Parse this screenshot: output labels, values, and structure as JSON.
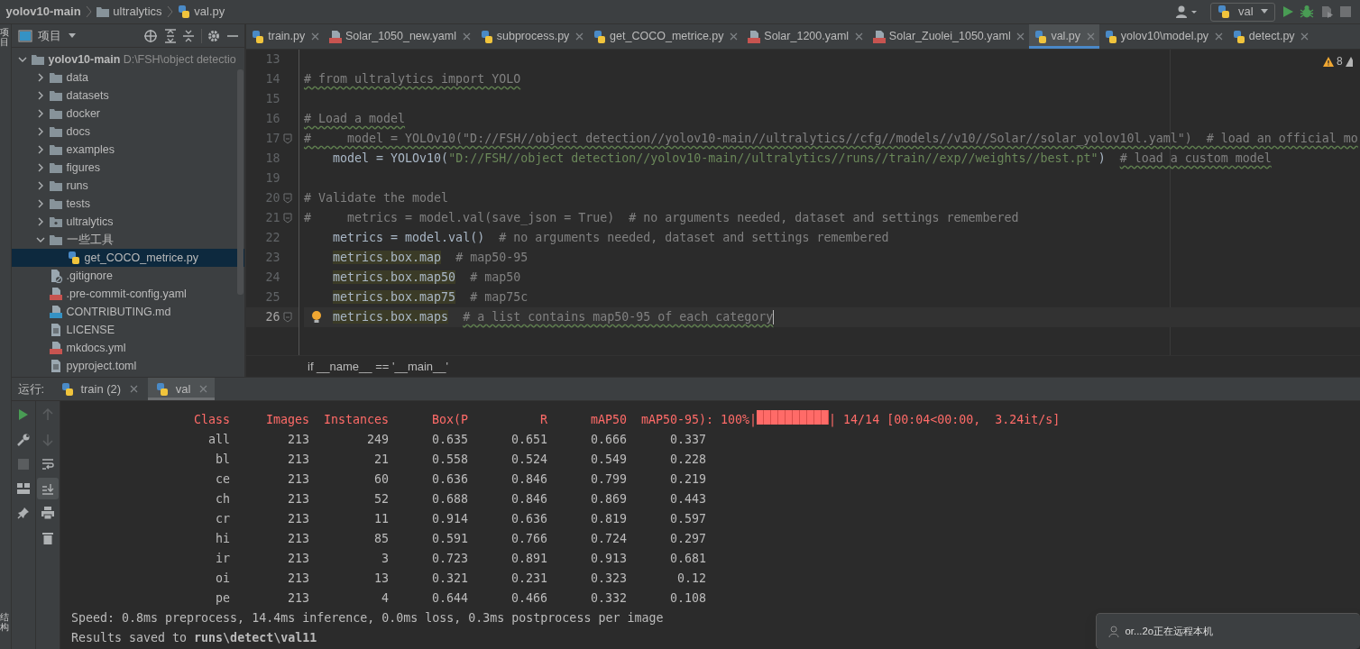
{
  "breadcrumb": [
    {
      "text": "yolov10-main",
      "kind": "project"
    },
    {
      "text": "ultralytics",
      "kind": "folder"
    },
    {
      "text": "val.py",
      "kind": "py"
    }
  ],
  "toolbar": {
    "run_config": "val"
  },
  "left_strip": {
    "top_label": "项目",
    "bottom_label": "结构"
  },
  "project_panel": {
    "title": "项目",
    "tree": [
      {
        "label": "yolov10-main",
        "path": "D:\\FSH\\object detectio",
        "kind": "root",
        "expanded": true,
        "selected": false,
        "children": [
          {
            "label": "data",
            "kind": "folder",
            "expanded": false,
            "selected": false
          },
          {
            "label": "datasets",
            "kind": "folder",
            "expanded": false,
            "selected": false
          },
          {
            "label": "docker",
            "kind": "folder",
            "expanded": false,
            "selected": false
          },
          {
            "label": "docs",
            "kind": "folder",
            "expanded": false,
            "selected": false
          },
          {
            "label": "examples",
            "kind": "folder",
            "expanded": false,
            "selected": false
          },
          {
            "label": "figures",
            "kind": "folder",
            "expanded": false,
            "selected": false
          },
          {
            "label": "runs",
            "kind": "folder",
            "expanded": false,
            "selected": false
          },
          {
            "label": "tests",
            "kind": "folder",
            "expanded": false,
            "selected": false
          },
          {
            "label": "ultralytics",
            "kind": "package",
            "expanded": false,
            "selected": false
          },
          {
            "label": "一些工具",
            "kind": "folder",
            "expanded": true,
            "selected": false,
            "children": [
              {
                "label": "get_COCO_metrice.py",
                "kind": "py",
                "selected": true
              }
            ]
          },
          {
            "label": ".gitignore",
            "kind": "ignore",
            "selected": false
          },
          {
            "label": ".pre-commit-config.yaml",
            "kind": "yaml",
            "selected": false
          },
          {
            "label": "CONTRIBUTING.md",
            "kind": "md",
            "selected": false
          },
          {
            "label": "LICENSE",
            "kind": "text",
            "selected": false
          },
          {
            "label": "mkdocs.yml",
            "kind": "yaml",
            "selected": false
          },
          {
            "label": "pyproject.toml",
            "kind": "text",
            "selected": false
          }
        ]
      }
    ]
  },
  "editor_tabs": [
    {
      "label": "train.py",
      "kind": "py",
      "selected": false
    },
    {
      "label": "Solar_1050_new.yaml",
      "kind": "yaml",
      "selected": false
    },
    {
      "label": "subprocess.py",
      "kind": "py",
      "selected": false
    },
    {
      "label": "get_COCO_metrice.py",
      "kind": "py",
      "selected": false
    },
    {
      "label": "Solar_1200.yaml",
      "kind": "yaml",
      "selected": false
    },
    {
      "label": "Solar_Zuolei_1050.yaml",
      "kind": "yaml",
      "selected": false
    },
    {
      "label": "val.py",
      "kind": "py",
      "selected": true
    },
    {
      "label": "yolov10\\model.py",
      "kind": "py",
      "selected": false
    },
    {
      "label": "detect.py",
      "kind": "py",
      "selected": false
    }
  ],
  "editor": {
    "warnings": "8",
    "lines": [
      {
        "number": "13",
        "fold": false,
        "current": false,
        "hint": false
      },
      {
        "number": "14",
        "fold": false,
        "current": false,
        "hint": false,
        "segments": [
          {
            "kind": "comment_warn",
            "text": "# from ultralytics import YOLO"
          }
        ]
      },
      {
        "number": "15",
        "fold": false,
        "current": false,
        "hint": false
      },
      {
        "number": "16",
        "fold": false,
        "current": false,
        "hint": false,
        "segments": [
          {
            "kind": "comment_warn",
            "text": "# Load a model"
          }
        ]
      },
      {
        "number": "17",
        "fold": true,
        "current": false,
        "hint": false,
        "segments": [
          {
            "kind": "comment_warn",
            "text": "#     model = YOLOv10(\"D://FSH//object detection//yolov10-main//ultralytics//cfg//models//v10//Solar//solar_yolov10l.yaml\")  # load an official mo"
          }
        ]
      },
      {
        "number": "18",
        "fold": false,
        "current": false,
        "hint": false,
        "segments": [
          {
            "kind": "code",
            "text": "    model = YOLOv10("
          },
          {
            "kind": "string",
            "text": "\"D://FSH//object detection//yolov10-main//ultralytics//runs//train//exp//weights//best.pt\""
          },
          {
            "kind": "code",
            "text": ")  "
          },
          {
            "kind": "comment_warn",
            "text": "# load a custom model"
          }
        ]
      },
      {
        "number": "19",
        "fold": false,
        "current": false,
        "hint": false
      },
      {
        "number": "20",
        "fold": true,
        "current": false,
        "hint": false,
        "segments": [
          {
            "kind": "comment",
            "text": "# Validate the model"
          }
        ]
      },
      {
        "number": "21",
        "fold": true,
        "current": false,
        "hint": false,
        "segments": [
          {
            "kind": "comment",
            "text": "#     metrics = model.val(save_json = True)  # no arguments needed, dataset and settings remembered"
          }
        ]
      },
      {
        "number": "22",
        "fold": false,
        "current": false,
        "hint": false,
        "segments": [
          {
            "kind": "code",
            "text": "    metrics = model.val()  "
          },
          {
            "kind": "comment",
            "text": "# no arguments needed, dataset and settings remembered"
          }
        ]
      },
      {
        "number": "23",
        "fold": false,
        "current": false,
        "hint": false,
        "indented": true,
        "segments": [
          {
            "kind": "highlight",
            "text": "metrics.box.map"
          },
          {
            "kind": "comment",
            "text": "  # map50-95"
          }
        ]
      },
      {
        "number": "24",
        "fold": false,
        "current": false,
        "hint": false,
        "indented": true,
        "segments": [
          {
            "kind": "highlight",
            "text": "metrics.box.map50"
          },
          {
            "kind": "comment",
            "text": "  # map50"
          }
        ]
      },
      {
        "number": "25",
        "fold": false,
        "current": false,
        "hint": false,
        "indented": true,
        "segments": [
          {
            "kind": "highlight",
            "text": "metrics.box.map75"
          },
          {
            "kind": "comment",
            "text": "  # map75c"
          }
        ]
      },
      {
        "number": "26",
        "fold": true,
        "current": true,
        "hint": true,
        "indented": true,
        "segments": [
          {
            "kind": "highlight",
            "text": "metrics.box.maps"
          },
          {
            "kind": "comment_warn",
            "text": "  # a list contains map50-95 of each category"
          }
        ]
      }
    ]
  },
  "editor_breadcrumb": "if __name__ == '__main__'",
  "run_panel": {
    "label": "运行:",
    "tabs": [
      {
        "label": "train (2)",
        "selected": false
      },
      {
        "label": "val",
        "selected": true
      }
    ],
    "console": {
      "header": {
        "columns": [
          "Class",
          "Images",
          "Instances",
          "Box(P",
          "R",
          "mAP50",
          "mAP50-95):"
        ],
        "progress": {
          "prefix": "100%|",
          "level": 1,
          "suffix": "| 14/14 [00:04<00:00,  3.24it/s]"
        }
      },
      "rows": [
        [
          "all",
          "213",
          "249",
          "0.635",
          "0.651",
          "0.666",
          "0.337"
        ],
        [
          "bl",
          "213",
          "21",
          "0.558",
          "0.524",
          "0.549",
          "0.228"
        ],
        [
          "ce",
          "213",
          "60",
          "0.636",
          "0.846",
          "0.799",
          "0.219"
        ],
        [
          "ch",
          "213",
          "52",
          "0.688",
          "0.846",
          "0.869",
          "0.443"
        ],
        [
          "cr",
          "213",
          "11",
          "0.914",
          "0.636",
          "0.819",
          "0.597"
        ],
        [
          "hi",
          "213",
          "85",
          "0.591",
          "0.766",
          "0.724",
          "0.297"
        ],
        [
          "ir",
          "213",
          "3",
          "0.723",
          "0.891",
          "0.913",
          "0.681"
        ],
        [
          "oi",
          "213",
          "13",
          "0.321",
          "0.231",
          "0.323",
          "0.12"
        ],
        [
          "pe",
          "213",
          "4",
          "0.644",
          "0.466",
          "0.332",
          "0.108"
        ]
      ],
      "footer": [
        "Speed: 0.8ms preprocess, 14.4ms inference, 0.0ms loss, 0.3ms postprocess per image",
        "Results saved to **runs\\detect\\val11**"
      ]
    }
  },
  "notification": "or...2o正在远程本机"
}
